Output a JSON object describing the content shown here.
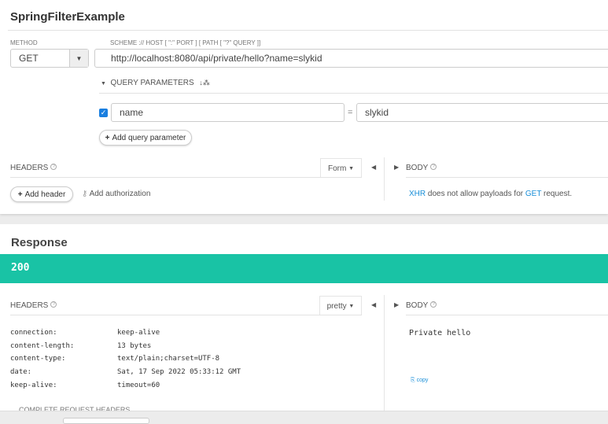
{
  "request": {
    "title": "SpringFilterExample",
    "method_label": "METHOD",
    "method": "GET",
    "url_label": "SCHEME :// HOST [ \":\" PORT ] [ PATH [ \"?\" QUERY ]]",
    "url": "http://localhost:8080/api/private/hello?name=slykid",
    "query_params_label": "QUERY PARAMETERS",
    "query_params": [
      {
        "checked": true,
        "name": "name",
        "value": "slykid"
      }
    ],
    "equals": "=",
    "add_query_param": "Add query parameter",
    "headers_label": "HEADERS",
    "headers_mode": "Form",
    "add_header": "Add header",
    "add_authorization": "Add authorization",
    "body_label": "BODY",
    "body_msg": {
      "xhr": "XHR",
      "mid": " does not allow payloads for ",
      "get": "GET",
      "end": " request."
    }
  },
  "response": {
    "title": "Response",
    "status": "200",
    "status_color": "#19c3a5",
    "headers_label": "HEADERS",
    "headers_mode": "pretty",
    "body_label": "BODY",
    "headers": [
      {
        "key": "connection:",
        "value": "keep-alive"
      },
      {
        "key": "content-length:",
        "value": "13 bytes"
      },
      {
        "key": "content-type:",
        "value": "text/plain;charset=UTF-8"
      },
      {
        "key": "date:",
        "value": "Sat, 17 Sep 2022 05:33:12 GMT"
      },
      {
        "key": "keep-alive:",
        "value": "timeout=60"
      }
    ],
    "body": "Private hello",
    "copy": "copy",
    "complete_headers": "COMPLETE REQUEST HEADERS"
  }
}
